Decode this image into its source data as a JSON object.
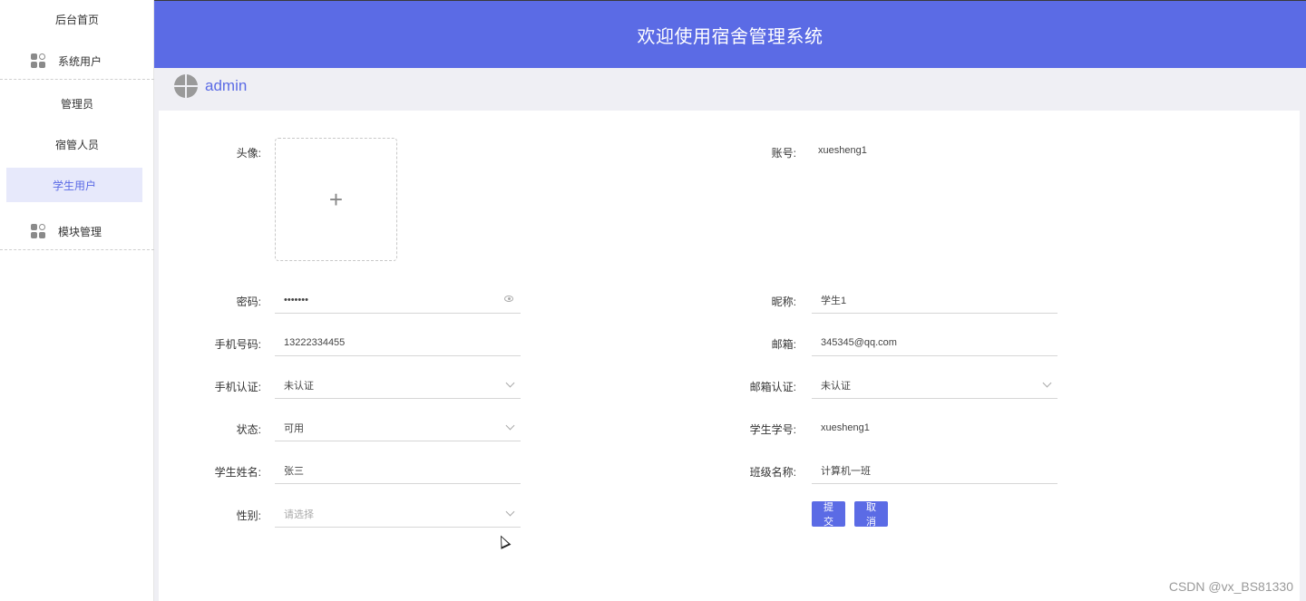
{
  "sidebar": {
    "home": "后台首页",
    "system_users": "系统用户",
    "admin": "管理员",
    "dorm_staff": "宿管人员",
    "student_users": "学生用户",
    "module_mgmt": "模块管理"
  },
  "header": {
    "title": "欢迎使用宿舍管理系统"
  },
  "userbar": {
    "username": "admin"
  },
  "form": {
    "avatar_label": "头像:",
    "account_label": "账号:",
    "account_value": "xuesheng1",
    "password_label": "密码:",
    "password_value": "•••••••",
    "nickname_label": "昵称:",
    "nickname_value": "学生1",
    "phone_label": "手机号码:",
    "phone_value": "13222334455",
    "email_label": "邮箱:",
    "email_value": "345345@qq.com",
    "phone_verify_label": "手机认证:",
    "phone_verify_value": "未认证",
    "email_verify_label": "邮箱认证:",
    "email_verify_value": "未认证",
    "status_label": "状态:",
    "status_value": "可用",
    "student_no_label": "学生学号:",
    "student_no_value": "xuesheng1",
    "student_name_label": "学生姓名:",
    "student_name_value": "张三",
    "class_label": "班级名称:",
    "class_value": "计算机一班",
    "gender_label": "性别:",
    "gender_placeholder": "请选择"
  },
  "buttons": {
    "submit": "提交",
    "cancel": "取消"
  },
  "watermark": "CSDN @vx_BS81330",
  "colors": {
    "accent": "#5b6be5",
    "active_bg": "#e7e9fb",
    "page_bg": "#efeff4"
  }
}
